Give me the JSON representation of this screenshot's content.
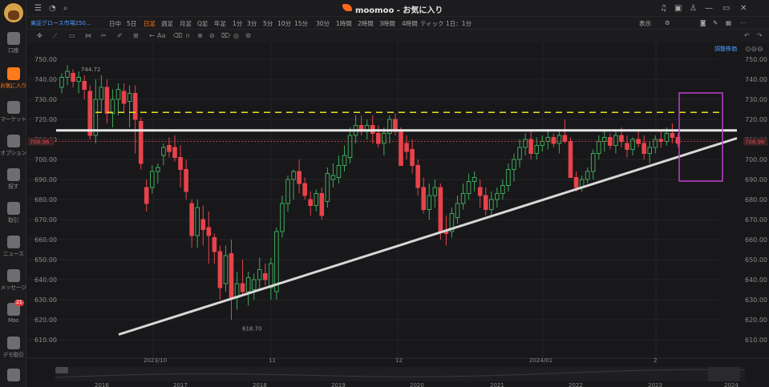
{
  "window": {
    "title": "moomoo - お気に入り"
  },
  "sidebar": {
    "items": [
      {
        "label": "口座",
        "icon": "account-icon"
      },
      {
        "label": "お気に入り",
        "icon": "watchlist-icon",
        "active": true
      },
      {
        "label": "マーケット",
        "icon": "market-icon"
      },
      {
        "label": "オプション",
        "icon": "options-icon"
      },
      {
        "label": "探す",
        "icon": "screener-icon"
      },
      {
        "label": "取引",
        "icon": "trade-icon"
      },
      {
        "label": "ニュース",
        "icon": "news-icon"
      },
      {
        "label": "メッセージ",
        "icon": "message-icon"
      },
      {
        "label": "Moo",
        "icon": "moo-icon",
        "badge": "21"
      },
      {
        "label": "デモ取引",
        "icon": "paper-trade-icon"
      },
      {
        "label": "",
        "icon": "expand-icon"
      }
    ]
  },
  "toolbar": {
    "symbol": "東証グロース市場250...",
    "timeframes": [
      "日中",
      "5日",
      "日足",
      "週足",
      "月足",
      "Q足",
      "年足",
      "1分",
      "3分",
      "5分",
      "10分",
      "15分",
      "30分",
      "1時間",
      "2時間",
      "3時間",
      "4時間",
      "ティック"
    ],
    "selected": "日足",
    "interval": "1日：1分",
    "display": "表示",
    "adjust": "調整株価"
  },
  "chart_data": {
    "type": "candlestick",
    "price_axis": {
      "ticks": [
        750,
        740,
        730,
        720,
        710,
        700,
        690,
        680,
        670,
        660,
        650,
        640,
        630,
        620,
        610
      ],
      "unit": "JPY"
    },
    "current_price": "708.96",
    "high_label": "744.72",
    "low_label": "618.70",
    "x_labels": [
      "2023/10",
      "11",
      "12",
      "2024/01",
      "2"
    ],
    "range_labels": [
      "2016",
      "2017",
      "2018",
      "2019",
      "2020",
      "2021",
      "2022",
      "2023",
      "2024"
    ],
    "colors": {
      "up": "#3ea85a",
      "down": "#e8434a",
      "support": "#d8d8d8",
      "resistance": "#e6e6e6",
      "target": "#e8e020",
      "box": "#c040d0"
    },
    "candles": [
      [
        736,
        743,
        733,
        741
      ],
      [
        741,
        747,
        737,
        744
      ],
      [
        743,
        745,
        736,
        739
      ],
      [
        739,
        744,
        733,
        741
      ],
      [
        739,
        742,
        730,
        735
      ],
      [
        734,
        737,
        710,
        712
      ],
      [
        712,
        740,
        708,
        730
      ],
      [
        730,
        742,
        724,
        736
      ],
      [
        736,
        740,
        718,
        723
      ],
      [
        723,
        735,
        716,
        730
      ],
      [
        730,
        738,
        722,
        735
      ],
      [
        734,
        738,
        723,
        728
      ],
      [
        729,
        737,
        716,
        733
      ],
      [
        733,
        737,
        703,
        720
      ],
      [
        719,
        721,
        695,
        698
      ],
      [
        686,
        690,
        674,
        678
      ],
      [
        686,
        697,
        683,
        694
      ],
      [
        694,
        698,
        688,
        696
      ],
      [
        702,
        708,
        697,
        706
      ],
      [
        707,
        711,
        701,
        704
      ],
      [
        706,
        712,
        699,
        701
      ],
      [
        701,
        707,
        686,
        695
      ],
      [
        695,
        700,
        680,
        684
      ],
      [
        678,
        680,
        656,
        662
      ],
      [
        662,
        680,
        656,
        676
      ],
      [
        670,
        677,
        657,
        665
      ],
      [
        666,
        674,
        648,
        662
      ],
      [
        661,
        663,
        648,
        654
      ],
      [
        654,
        657,
        630,
        636
      ],
      [
        638,
        657,
        634,
        652
      ],
      [
        653,
        660,
        620,
        631
      ],
      [
        631,
        644,
        625,
        638
      ],
      [
        638,
        650,
        632,
        634
      ],
      [
        634,
        644,
        627,
        641
      ],
      [
        635,
        643,
        630,
        640
      ],
      [
        640,
        651,
        635,
        645
      ],
      [
        643,
        648,
        637,
        640
      ],
      [
        636,
        651,
        630,
        648
      ],
      [
        634,
        666,
        630,
        664
      ],
      [
        664,
        682,
        661,
        678
      ],
      [
        678,
        692,
        674,
        690
      ],
      [
        690,
        695,
        680,
        694
      ],
      [
        694,
        700,
        683,
        688
      ],
      [
        688,
        691,
        680,
        682
      ],
      [
        680,
        684,
        672,
        677
      ],
      [
        677,
        685,
        674,
        683
      ],
      [
        683,
        686,
        670,
        672
      ],
      [
        679,
        696,
        676,
        693
      ],
      [
        690,
        698,
        686,
        692
      ],
      [
        691,
        702,
        688,
        697
      ],
      [
        697,
        707,
        694,
        702
      ],
      [
        701,
        716,
        698,
        712
      ],
      [
        712,
        722,
        708,
        717
      ],
      [
        717,
        722,
        712,
        714
      ],
      [
        714,
        720,
        710,
        717
      ],
      [
        717,
        722,
        708,
        713
      ],
      [
        713,
        717,
        706,
        708
      ],
      [
        708,
        716,
        702,
        713
      ],
      [
        713,
        722,
        708,
        720
      ],
      [
        720,
        723,
        712,
        714
      ],
      [
        714,
        716,
        700,
        697
      ],
      [
        708,
        712,
        700,
        704
      ],
      [
        705,
        710,
        693,
        697
      ],
      [
        697,
        700,
        682,
        686
      ],
      [
        686,
        691,
        673,
        675
      ],
      [
        675,
        688,
        670,
        682
      ],
      [
        682,
        690,
        676,
        686
      ],
      [
        686,
        688,
        660,
        664
      ],
      [
        664,
        672,
        657,
        663
      ],
      [
        664,
        676,
        661,
        673
      ],
      [
        671,
        682,
        668,
        678
      ],
      [
        678,
        688,
        675,
        683
      ],
      [
        683,
        693,
        680,
        689
      ],
      [
        689,
        694,
        684,
        691
      ],
      [
        686,
        690,
        676,
        682
      ],
      [
        682,
        686,
        672,
        675
      ],
      [
        675,
        684,
        671,
        680
      ],
      [
        680,
        686,
        676,
        683
      ],
      [
        683,
        690,
        680,
        687
      ],
      [
        687,
        698,
        684,
        695
      ],
      [
        695,
        703,
        689,
        700
      ],
      [
        700,
        710,
        696,
        706
      ],
      [
        706,
        713,
        702,
        710
      ],
      [
        710,
        714,
        700,
        703
      ],
      [
        703,
        711,
        700,
        707
      ],
      [
        707,
        712,
        704,
        709
      ],
      [
        709,
        714,
        705,
        711
      ],
      [
        711,
        713,
        706,
        708
      ],
      [
        708,
        715,
        703,
        712
      ],
      [
        712,
        720,
        708,
        709
      ],
      [
        709,
        711,
        693,
        691
      ],
      [
        691,
        694,
        684,
        686
      ],
      [
        686,
        692,
        684,
        690
      ],
      [
        690,
        696,
        688,
        694
      ],
      [
        694,
        705,
        690,
        703
      ],
      [
        703,
        712,
        700,
        709
      ],
      [
        709,
        715,
        704,
        711
      ],
      [
        711,
        713,
        705,
        707
      ],
      [
        707,
        714,
        703,
        712
      ],
      [
        712,
        716,
        706,
        709
      ],
      [
        708,
        712,
        701,
        705
      ],
      [
        705,
        711,
        702,
        710
      ],
      [
        710,
        714,
        706,
        708
      ],
      [
        708,
        712,
        700,
        703
      ],
      [
        703,
        709,
        698,
        706
      ],
      [
        706,
        712,
        703,
        710
      ],
      [
        710,
        714,
        706,
        709
      ],
      [
        709,
        716,
        707,
        713
      ],
      [
        713,
        718,
        708,
        711
      ],
      [
        711,
        713,
        706,
        708
      ]
    ],
    "lines": {
      "resistance": 714.5,
      "target": 723.5
    }
  }
}
